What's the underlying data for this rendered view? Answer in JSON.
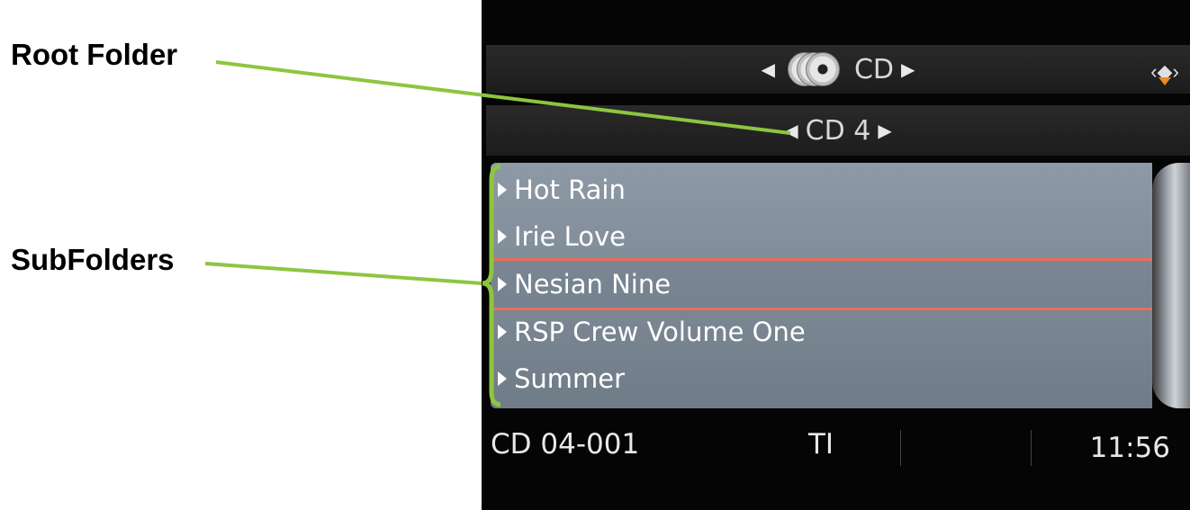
{
  "annotations": {
    "root_folder": "Root Folder",
    "subfolders": "SubFolders",
    "leader_color": "#8cc63f"
  },
  "header": {
    "source_label": "CD",
    "source_icon": "disc-stack-icon",
    "nav_icon": "joystick-icon"
  },
  "folder_bar": {
    "label": "CD 4"
  },
  "list": {
    "items": [
      {
        "label": "Hot Rain"
      },
      {
        "label": "Irie Love"
      },
      {
        "label": "Nesian Nine",
        "selected": true
      },
      {
        "label": "RSP Crew Volume One"
      },
      {
        "label": "Summer"
      }
    ],
    "highlight_color": "#e8705a"
  },
  "status_bar": {
    "track": "CD 04-001",
    "ti": "TI",
    "clock": "11:56"
  }
}
